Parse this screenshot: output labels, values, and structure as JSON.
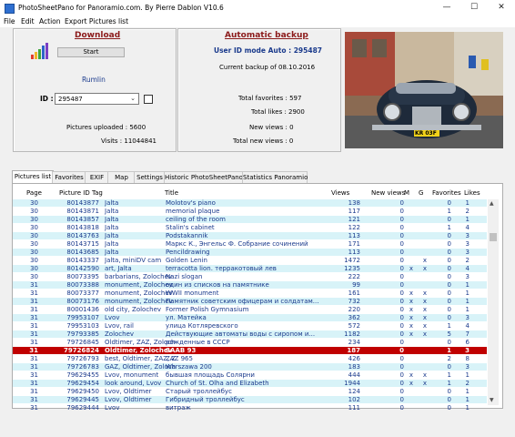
{
  "window": {
    "title": "PhotoSheetPano for Panoramio.com.  By Pierre Dablon   V10.6",
    "minimize": "—",
    "maximize": "☐",
    "close": "✕"
  },
  "menu": [
    "File",
    "Edit",
    "Action",
    "Export Pictures list"
  ],
  "download": {
    "title": "Download",
    "start_label": "Start",
    "user_name": "Rumlin",
    "id_label": "ID :",
    "id_value": "295487",
    "pictures_uploaded": "Pictures uploaded : 5600",
    "visits": "Visits : 11044841"
  },
  "backup": {
    "title": "Automatic backup",
    "mode": "User ID mode Auto : 295487",
    "current": "Current backup of 08.10.2016",
    "total_favorites": "Total favorites : 597",
    "total_likes": "Total likes : 2900",
    "new_views": "New views : 0",
    "total_new_views": "Total new views : 0"
  },
  "photo": {
    "plate": "KR 03F"
  },
  "tabs": [
    "Pictures list",
    "Favorites",
    "EXIF",
    "Map",
    "Settings",
    "Historic PhotoSheetPano",
    "Statistics Panoramio"
  ],
  "columns": [
    "Page",
    "Picture ID",
    "Tag",
    "Title",
    "Views",
    "New views",
    "M",
    "G",
    "Favorites",
    "Likes"
  ],
  "rows": [
    [
      "30",
      "80143877",
      "Jalta",
      "Molotov's piano",
      "138",
      "0",
      "",
      "",
      "0",
      "1"
    ],
    [
      "30",
      "80143871",
      "Jalta",
      "memorial plaque",
      "117",
      "0",
      "",
      "",
      "1",
      "2"
    ],
    [
      "30",
      "80143857",
      "Jalta",
      "ceiling of the room",
      "121",
      "0",
      "",
      "",
      "0",
      "1"
    ],
    [
      "30",
      "80143818",
      "Jalta",
      "Stalin's cabinet",
      "122",
      "0",
      "",
      "",
      "1",
      "4"
    ],
    [
      "30",
      "80143763",
      "Jalta",
      "Podstakannik",
      "113",
      "0",
      "",
      "",
      "0",
      "3"
    ],
    [
      "30",
      "80143715",
      "Jalta",
      "Маркс К., Энгельс Ф. Собрание сочинений",
      "171",
      "0",
      "",
      "",
      "0",
      "3"
    ],
    [
      "30",
      "80143685",
      "Jalta",
      "Pencildrawing",
      "113",
      "0",
      "",
      "",
      "0",
      "3"
    ],
    [
      "30",
      "80143337",
      "Jalta, miniDV cam",
      "Golden Lenin",
      "1472",
      "0",
      "",
      "x",
      "0",
      "2"
    ],
    [
      "30",
      "80142590",
      "art, Jalta",
      "terracotta lion. терракотовый лев",
      "1235",
      "0",
      "x",
      "x",
      "0",
      "4"
    ],
    [
      "30",
      "80073395",
      "barbarians, Zolochev",
      "Nazi slogan",
      "222",
      "0",
      "",
      "",
      "0",
      "3"
    ],
    [
      "31",
      "80073388",
      "monument, Zolochev",
      "один из списков на памятнике",
      "99",
      "0",
      "",
      "",
      "0",
      "1"
    ],
    [
      "31",
      "80073377",
      "monument, Zolochev",
      "WWII monument",
      "161",
      "0",
      "x",
      "x",
      "0",
      "1"
    ],
    [
      "31",
      "80073176",
      "monument, Zolochev",
      "Памятник советским офицерам и солдатам...",
      "732",
      "0",
      "x",
      "x",
      "0",
      "1"
    ],
    [
      "31",
      "80001436",
      "old city, Zolochev",
      "Former Polish Gymnasium",
      "220",
      "0",
      "x",
      "x",
      "0",
      "1"
    ],
    [
      "31",
      "79953107",
      "Lvov",
      "ул. Матейка",
      "362",
      "0",
      "x",
      "x",
      "0",
      "3"
    ],
    [
      "31",
      "79953103",
      "Lvov, rail",
      "улица Котляревского",
      "572",
      "0",
      "x",
      "x",
      "1",
      "4"
    ],
    [
      "31",
      "79793385",
      "Zolochev",
      "Действующие автоматы воды с сиропом и...",
      "1182",
      "0",
      "x",
      "x",
      "5",
      "7"
    ],
    [
      "31",
      "79726845",
      "Oldtimer, ZAZ, Zolochev",
      "рожденные в СССР",
      "234",
      "0",
      "",
      "",
      "0",
      "6"
    ],
    [
      "31",
      "79726824",
      "Oldtimer, Zolochev",
      "SAAB 93",
      "187",
      "0",
      "",
      "",
      "1",
      "3"
    ],
    [
      "31",
      "79726793",
      "best, Oldtimer, ZAZ, Zol...",
      "ZAZ 965",
      "426",
      "0",
      "",
      "",
      "2",
      "8"
    ],
    [
      "31",
      "79726783",
      "GAZ, Oldtimer, Zolochev",
      "Warszawa 200",
      "183",
      "0",
      "",
      "",
      "0",
      "3"
    ],
    [
      "31",
      "79629455",
      "Lvov, monument",
      "бывшая площадь Солярни",
      "444",
      "0",
      "x",
      "x",
      "1",
      "1"
    ],
    [
      "31",
      "79629454",
      "look around, Lvov",
      "Church of St. Olha and Elizabeth",
      "1944",
      "0",
      "x",
      "x",
      "1",
      "2"
    ],
    [
      "31",
      "79629450",
      "Lvov, Oldtimer",
      "Старый троллейбус",
      "124",
      "0",
      "",
      "",
      "0",
      "1"
    ],
    [
      "31",
      "79629445",
      "Lvov, Oldtimer",
      "Гибридный троллейбус",
      "102",
      "0",
      "",
      "",
      "0",
      "1"
    ],
    [
      "31",
      "79629444",
      "Lvov",
      "витраж",
      "111",
      "0",
      "",
      "",
      "0",
      "1"
    ]
  ],
  "selected_row_index": 18,
  "colors": {
    "selected": "#c00000",
    "alt_row": "#d8f3f8",
    "link_red": "#8b1a1a",
    "blue": "#1a3a8c"
  }
}
